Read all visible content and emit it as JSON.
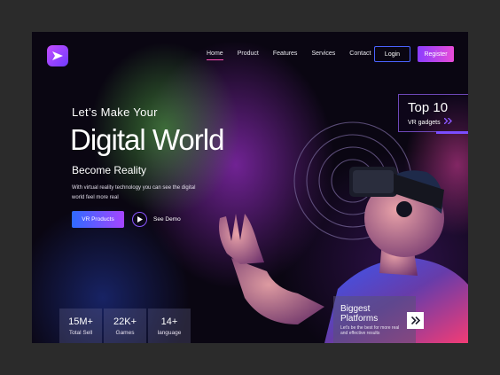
{
  "brand": {
    "logo_icon": "paper-plane-icon"
  },
  "nav": {
    "items": [
      "Home",
      "Product",
      "Features",
      "Services",
      "Contact"
    ],
    "active_index": 0
  },
  "auth": {
    "login_label": "Login",
    "register_label": "Register"
  },
  "hero": {
    "pretitle": "Let’s Make Your",
    "title": "Digital World",
    "subtitle": "Become Reality",
    "description": "With virtual reality technology you can see the digital world feel more real",
    "cta_label": "VR Products",
    "demo_label": "See Demo"
  },
  "stats": [
    {
      "value": "15M+",
      "label": "Total Sell"
    },
    {
      "value": "22K+",
      "label": "Games"
    },
    {
      "value": "14+",
      "label": "language"
    }
  ],
  "top10": {
    "title": "Top 10",
    "subtitle": "VR gadgets"
  },
  "platforms": {
    "title": "Biggest Platforms",
    "description": "Let's be the best for more real and effective results"
  },
  "colors": {
    "accent_purple": "#8b3dff",
    "accent_pink": "#e94cd8",
    "accent_blue": "#2f6bff",
    "background": "#0a0612"
  }
}
